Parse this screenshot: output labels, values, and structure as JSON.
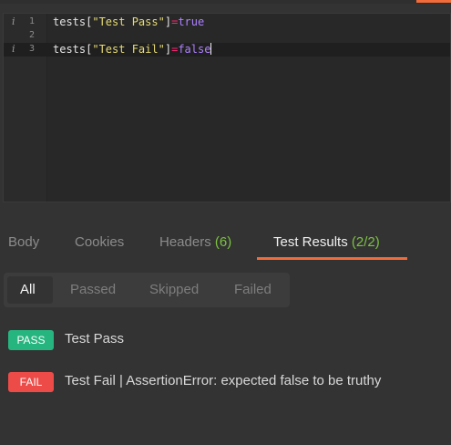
{
  "colors": {
    "accent": "#f26b3a",
    "pass": "#26b47f",
    "fail": "#ed4b48",
    "count": "#7cc242"
  },
  "editor": {
    "lines": [
      {
        "number": "1",
        "info_icon": "info-icon",
        "tokens": {
          "a": "tests[",
          "b": "\"Test Pass\"",
          "c": "]",
          "d": "=",
          "e": "true"
        }
      },
      {
        "number": "2"
      },
      {
        "number": "3",
        "info_icon": "info-icon",
        "tokens": {
          "a": "tests[",
          "b": "\"Test Fail\"",
          "c": "]",
          "d": "=",
          "e": "false"
        }
      }
    ]
  },
  "response_tabs": [
    {
      "label": "Body"
    },
    {
      "label": "Cookies"
    },
    {
      "label": "Headers",
      "count": "(6)"
    },
    {
      "label": "Test Results",
      "count": "(2/2)",
      "active": true
    }
  ],
  "filters": [
    "All",
    "Passed",
    "Skipped",
    "Failed"
  ],
  "results": [
    {
      "status": "PASS",
      "text": "Test Pass"
    },
    {
      "status": "FAIL",
      "text": "Test Fail | AssertionError: expected false to be truthy"
    }
  ]
}
